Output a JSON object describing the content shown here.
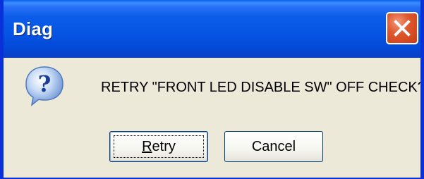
{
  "window": {
    "title": "Diag",
    "close_icon": "close-icon",
    "titlebar_color": "#0554e3",
    "close_color": "#e0582f"
  },
  "dialog": {
    "icon": "question-icon",
    "message": "RETRY \"FRONT LED DISABLE SW\" OFF CHECK?"
  },
  "buttons": {
    "retry": {
      "accel": "R",
      "rest": "etry"
    },
    "cancel_label": "Cancel"
  }
}
